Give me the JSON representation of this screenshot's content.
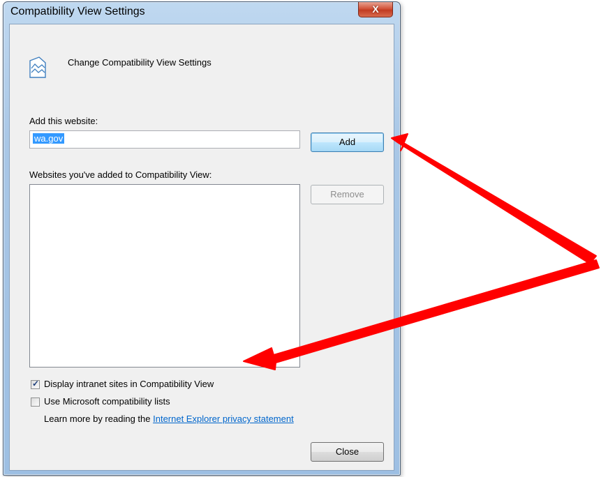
{
  "window": {
    "title": "Compatibility View Settings",
    "close_glyph": "X"
  },
  "header": {
    "icon": "compatibility-view-icon",
    "text": "Change Compatibility View Settings"
  },
  "add_site": {
    "label": "Add this website:",
    "value": "wa.gov",
    "button": "Add"
  },
  "added_sites": {
    "label": "Websites you've added to Compatibility View:",
    "items": [],
    "remove_button": "Remove"
  },
  "options": {
    "intranet": {
      "label": "Display intranet sites in Compatibility View",
      "checked": true
    },
    "ms_lists": {
      "label": "Use Microsoft compatibility lists",
      "checked": false
    }
  },
  "learn_more": {
    "prefix": "Learn more by reading the ",
    "link": "Internet Explorer privacy statement"
  },
  "footer": {
    "close_button": "Close"
  },
  "annotation": {
    "arrow_color": "#ff0000"
  }
}
